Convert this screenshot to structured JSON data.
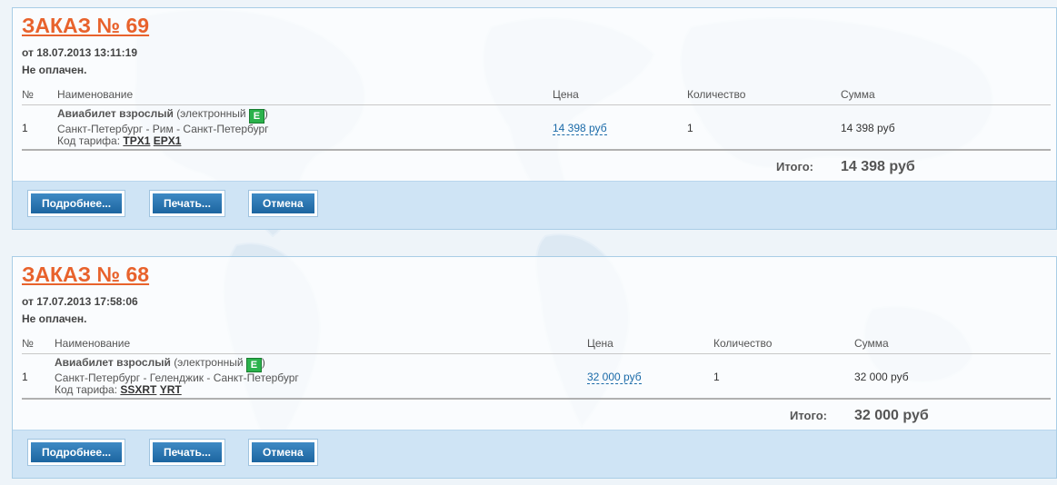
{
  "orders": [
    {
      "title": "ЗАКАЗ № 69",
      "date": "от 18.07.2013 13:11:19",
      "status": "Не оплачен.",
      "headers": {
        "num": "№",
        "name": "Наименование",
        "price": "Цена",
        "qty": "Количество",
        "sum": "Сумма"
      },
      "row": {
        "num": "1",
        "product": "Авиабилет взрослый",
        "type_prefix": "(электронный",
        "type_badge": "E",
        "type_suffix": ")",
        "route": "Санкт-Петербург - Рим - Санкт-Петербург",
        "fare_label": "Код тарифа:",
        "fare_codes": [
          "TPX1",
          "EPX1"
        ],
        "price": "14 398 руб",
        "qty": "1",
        "sum": "14 398 руб"
      },
      "total_label": "Итого:",
      "total_value": "14 398 руб",
      "buttons": {
        "details": "Подробнее...",
        "print": "Печать...",
        "cancel": "Отмена"
      }
    },
    {
      "title": "ЗАКАЗ № 68",
      "date": "от 17.07.2013 17:58:06",
      "status": "Не оплачен.",
      "headers": {
        "num": "№",
        "name": "Наименование",
        "price": "Цена",
        "qty": "Количество",
        "sum": "Сумма"
      },
      "row": {
        "num": "1",
        "product": "Авиабилет взрослый",
        "type_prefix": "(электронный",
        "type_badge": "E",
        "type_suffix": ")",
        "route": "Санкт-Петербург - Геленджик - Санкт-Петербург",
        "fare_label": "Код тарифа:",
        "fare_codes": [
          "SSXRT",
          "YRT"
        ],
        "price": "32 000 руб",
        "qty": "1",
        "sum": "32 000 руб"
      },
      "total_label": "Итого:",
      "total_value": "32 000 руб",
      "buttons": {
        "details": "Подробнее...",
        "print": "Печать...",
        "cancel": "Отмена"
      }
    }
  ],
  "colors": {
    "title": "#e8622c",
    "button": "#1e6fab",
    "footer": "#cfe4f5",
    "badge": "#2bb24c"
  },
  "icons": {
    "electronic_badge": "e-ticket-badge-icon",
    "background": "world-map-icon"
  }
}
